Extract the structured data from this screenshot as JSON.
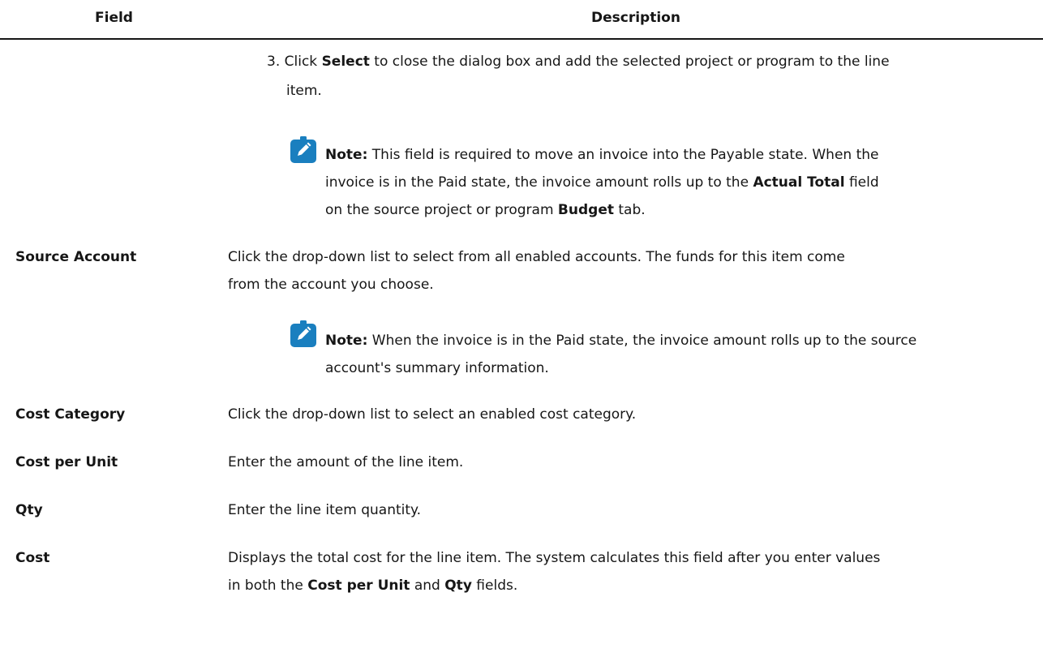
{
  "table": {
    "headers": {
      "field": "Field",
      "description": "Description"
    },
    "step3": {
      "number": "3.",
      "line1_pre": "Click ",
      "line1_bold": "Select",
      "line1_post": " to close the dialog box and add the selected project or program to the line",
      "line2": "item."
    },
    "note1": {
      "icon": "pencil-note-icon",
      "label": "Note:",
      "line1": " This field is required to move an invoice into the Payable state. When the",
      "line2_pre": "invoice is in the Paid state, the invoice amount rolls up to the ",
      "line2_bold": "Actual Total",
      "line2_post": " field",
      "line3_pre": "on the source project or program ",
      "line3_bold": "Budget",
      "line3_post": " tab."
    },
    "source_account": {
      "field": "Source Account",
      "line1": "Click the drop-down list to select from all enabled accounts. The funds for this item come",
      "line2": "from the account you choose."
    },
    "note2": {
      "icon": "pencil-note-icon",
      "label": "Note:",
      "line1": " When the invoice is in the Paid state, the invoice amount rolls up to the source",
      "line2": "account's summary information."
    },
    "cost_category": {
      "field": "Cost Category",
      "description": "Click the drop-down list to select an enabled cost category."
    },
    "cost_per_unit": {
      "field": "Cost per Unit",
      "description": "Enter the amount of the line item."
    },
    "qty": {
      "field": "Qty",
      "description": "Enter the line item quantity."
    },
    "cost": {
      "field": "Cost",
      "line1": "Displays the total cost for the line item. The system calculates this field after you enter values",
      "line2_pre": "in both the ",
      "line2_bold1": "Cost per Unit",
      "line2_mid": " and ",
      "line2_bold2": "Qty",
      "line2_post": " fields."
    }
  },
  "colors": {
    "icon_bg": "#1a7fbf",
    "text": "#161616"
  }
}
